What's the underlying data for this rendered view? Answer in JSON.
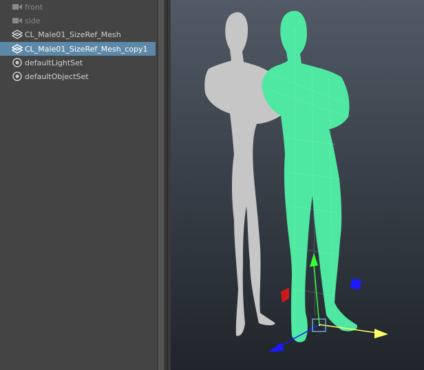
{
  "outliner": {
    "items": [
      {
        "label": "front",
        "icon": "camera-icon",
        "dim": true
      },
      {
        "label": "side",
        "icon": "camera-icon",
        "dim": true
      },
      {
        "label": "CL_Male01_SizeRef_Mesh",
        "icon": "mesh-icon",
        "dim": false
      },
      {
        "label": "CL_Male01_SizeRef_Mesh_copy1",
        "icon": "mesh-icon",
        "dim": false,
        "selected": true
      },
      {
        "label": "defaultLightSet",
        "icon": "set-icon",
        "dim": false
      },
      {
        "label": "defaultObjectSet",
        "icon": "set-icon",
        "dim": false
      }
    ]
  },
  "viewport": {
    "colors": {
      "reference_mesh": "#c6c6c6",
      "selected_mesh": "#4fe8a2",
      "wire": "#8ff5c6",
      "axis_x": "#ffff66",
      "axis_y": "#33ff33",
      "axis_z": "#1a1aff",
      "handle_red": "#cc1a1a"
    }
  }
}
